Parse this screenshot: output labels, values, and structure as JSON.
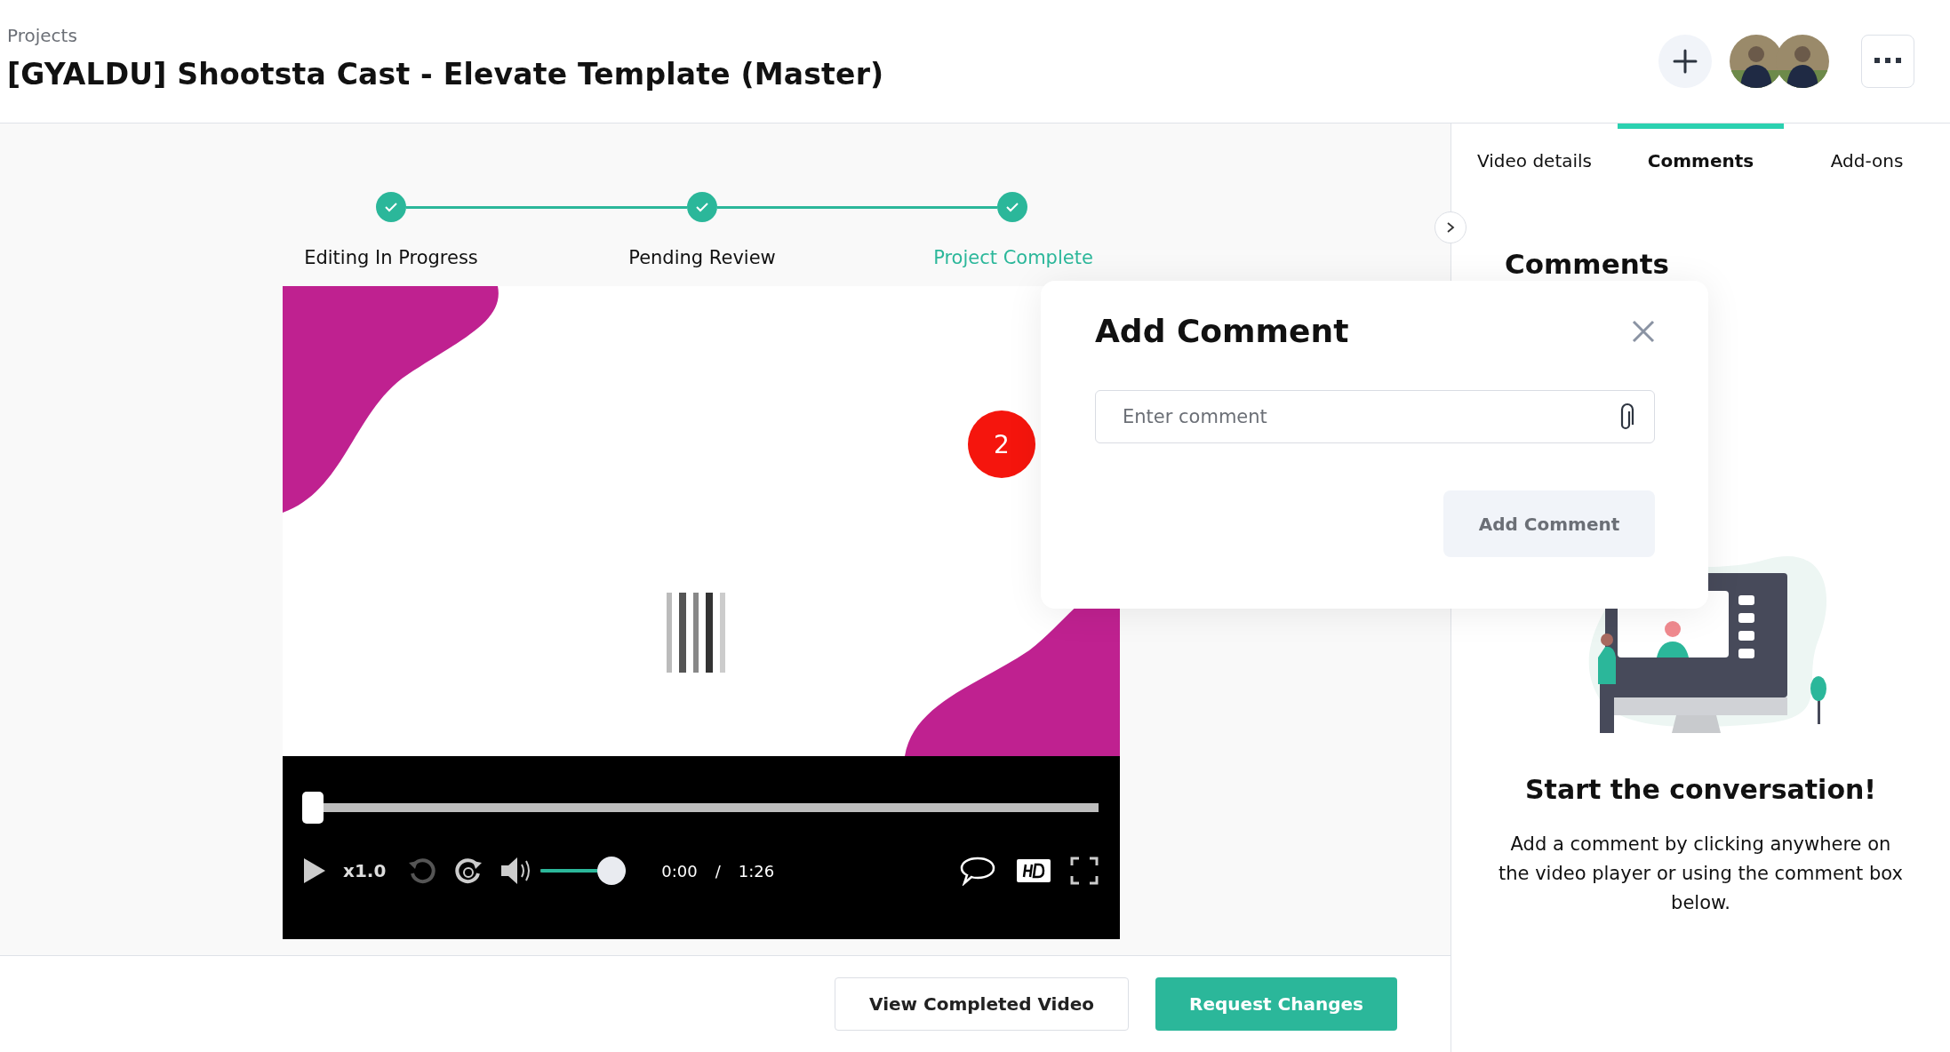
{
  "breadcrumb": "Projects",
  "title": "[GYALDU] Shootsta Cast - Elevate Template (Master)",
  "steps": [
    {
      "label": "Editing In Progress",
      "done": true,
      "selected": false
    },
    {
      "label": "Pending Review",
      "done": true,
      "selected": false
    },
    {
      "label": "Project Complete",
      "done": true,
      "selected": true
    }
  ],
  "player": {
    "progress": {
      "level": 0.0
    },
    "speed": "x1.0",
    "volume": {
      "level": 1.0
    },
    "time": "0:00",
    "separator": "/",
    "duration": "1:26"
  },
  "marker": {
    "label": "2"
  },
  "popup": {
    "title": "Add Comment",
    "field": {
      "placeholder": "Enter comment"
    },
    "button": "Add Comment"
  },
  "footer_buttons": [
    {
      "label": "View Completed Video",
      "kind": "secondary"
    },
    {
      "label": "Request Changes",
      "kind": "primary"
    }
  ],
  "tabs": [
    {
      "label": "Video details",
      "selected": false
    },
    {
      "label": "Comments",
      "selected": true
    },
    {
      "label": "Add-ons",
      "selected": false
    }
  ],
  "panel": {
    "heading": "Comments",
    "empty_title": "Start the conversation!",
    "empty_text": "Add a comment by clicking anywhere on the video player or using the comment box below."
  }
}
